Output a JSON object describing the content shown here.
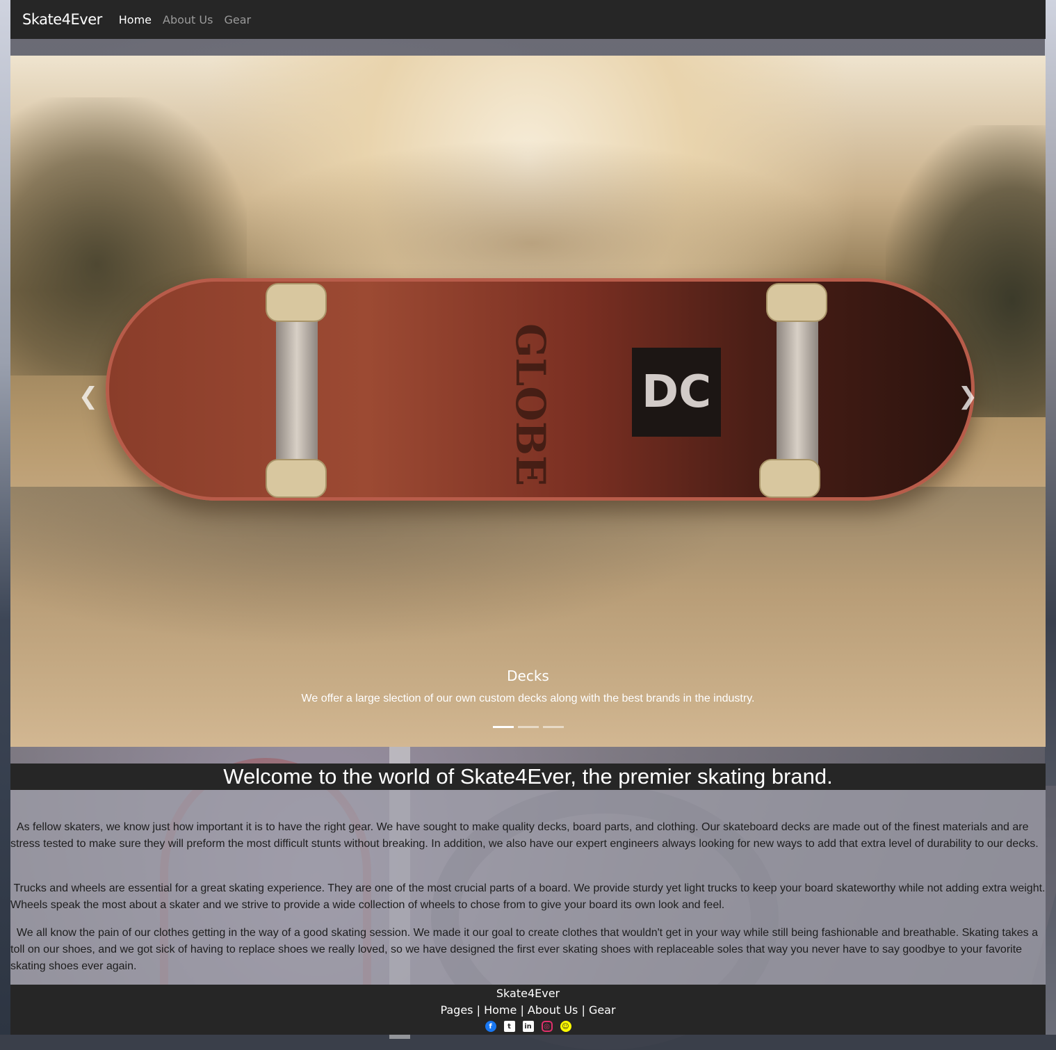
{
  "nav": {
    "brand": "Skate4Ever",
    "links": [
      {
        "label": "Home",
        "active": true
      },
      {
        "label": "About Us",
        "active": false
      },
      {
        "label": "Gear",
        "active": false
      }
    ]
  },
  "carousel": {
    "prev_icon": "chevron-left-icon",
    "next_icon": "chevron-right-icon",
    "slide": {
      "image": "skateboard-deck-photo",
      "deck_brand_text": "GLOBE",
      "deck_logo_text": "DC",
      "caption_title": "Decks",
      "caption_text": "We offer a large slection of our own custom decks along with the best brands in the industry."
    },
    "indicators": [
      true,
      false,
      false
    ]
  },
  "welcome": {
    "title": "Welcome to the world of Skate4Ever, the premier skating brand.",
    "paragraphs": [
      "  As fellow skaters, we know just how important it is to have the right gear. We have sought to make quality decks, board parts, and clothing. Our skateboard decks are made out of the finest materials and are stress tested to make sure they will preform the most difficult stunts without breaking. In addition, we also have our expert engineers always looking for new ways to add that extra level of durability to our decks.",
      " Trucks and wheels are essential for a great skating experience. They are one of the most crucial parts of a board. We provide sturdy yet light trucks to keep your board skateworthy while not adding extra weight. Wheels speak the most about a skater and we strive to provide a wide collection of wheels to chose from to give your board its own look and feel.",
      "  We all know the pain of our clothes getting in the way of a good skating session. We made it our goal to create clothes that wouldn't get in your way while still being fashionable and breathable. Skating takes a toll on our shoes, and we got sick of having to replace shoes we really loved, so we have designed the first ever skating shoes with replaceable soles that way you never have to say goodbye to your favorite skating shoes ever again."
    ]
  },
  "footer": {
    "brand": "Skate4Ever",
    "pages_label": "Pages",
    "separator": "|",
    "links": [
      "Home",
      "About Us",
      "Gear"
    ],
    "social": [
      {
        "name": "facebook-icon",
        "glyph": "f"
      },
      {
        "name": "twitter-icon",
        "glyph": "t"
      },
      {
        "name": "linkedin-icon",
        "glyph": "in"
      },
      {
        "name": "instagram-icon",
        "glyph": "◎"
      },
      {
        "name": "snapchat-icon",
        "glyph": "☺"
      }
    ]
  }
}
